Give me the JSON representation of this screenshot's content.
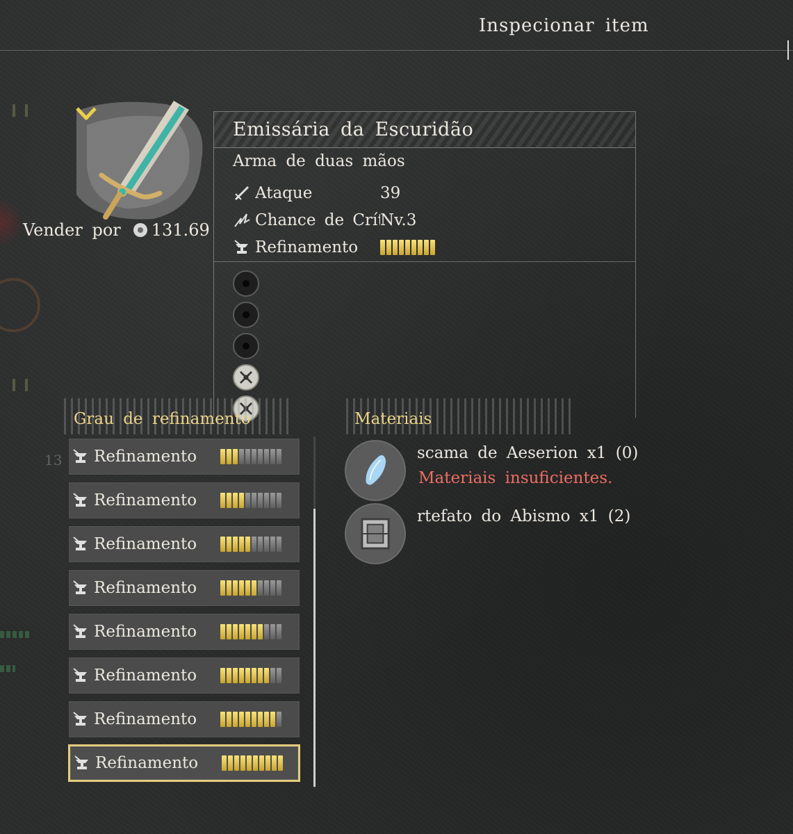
{
  "header": {
    "title": "Inspecionar item"
  },
  "item": {
    "name": "Emissária da Escuridão",
    "type": "Arma de duas mãos",
    "sell_label": "Vender por",
    "sell_price": "131.69",
    "rarity_icon": "chevron-down-icon",
    "stats": [
      {
        "icon": "sword-icon",
        "label": "Ataque",
        "value": "39"
      },
      {
        "icon": "crit-icon",
        "label": "Chance de Crít",
        "value": "Nv.3"
      },
      {
        "icon": "anvil-icon",
        "label": "Refinamento",
        "value": "",
        "refine_level": 9,
        "refine_max": 9
      }
    ],
    "slots": [
      "empty",
      "empty",
      "empty",
      "rune",
      "rune"
    ]
  },
  "refinement": {
    "title": "Grau de refinamento",
    "levels": [
      {
        "label": "Refinamento",
        "filled": 3,
        "max": 10
      },
      {
        "label": "Refinamento",
        "filled": 4,
        "max": 10
      },
      {
        "label": "Refinamento",
        "filled": 5,
        "max": 10
      },
      {
        "label": "Refinamento",
        "filled": 6,
        "max": 10
      },
      {
        "label": "Refinamento",
        "filled": 7,
        "max": 10
      },
      {
        "label": "Refinamento",
        "filled": 8,
        "max": 10
      },
      {
        "label": "Refinamento",
        "filled": 9,
        "max": 10
      },
      {
        "label": "Refinamento",
        "filled": 10,
        "max": 10
      }
    ],
    "selected_index": 7
  },
  "materials": {
    "title": "Materiais",
    "items": [
      {
        "name": "scama de Aeserion x1 (0)",
        "warning": "Materiais insuficientes.",
        "icon": "scale-icon"
      },
      {
        "name": "rtefato do Abismo x1 (2)",
        "warning": "",
        "icon": "cube-artifact-icon"
      }
    ]
  },
  "colors": {
    "accent_gold": "#e5cd7e",
    "warning": "#ec6e63",
    "bar_on": "#e8c84a",
    "bar_off": "#7a7a7a"
  }
}
